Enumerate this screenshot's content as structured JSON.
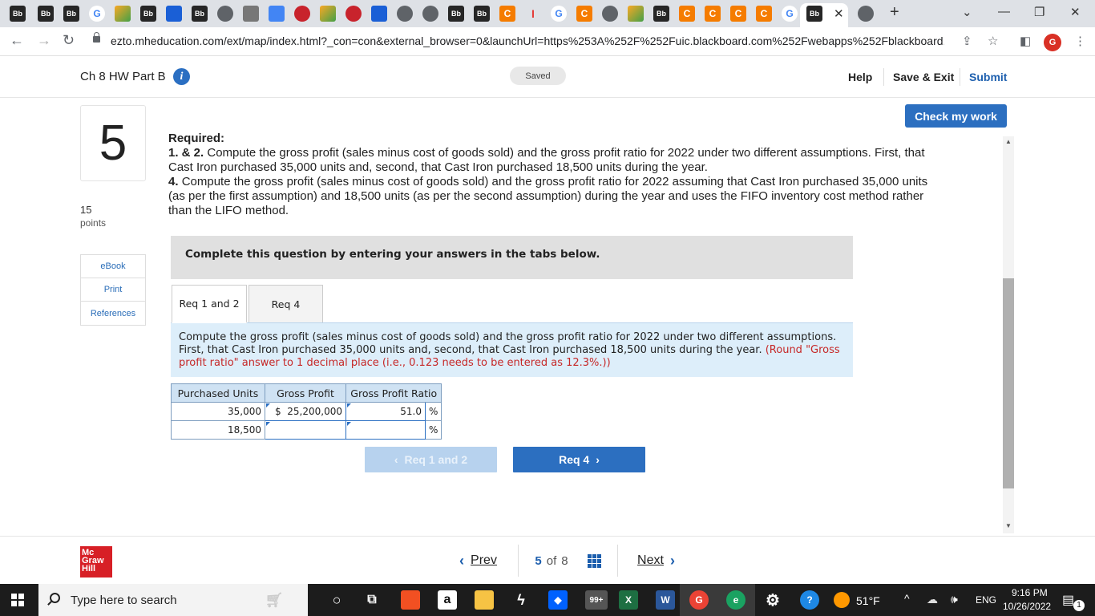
{
  "browser": {
    "url": "ezto.mheducation.com/ext/map/index.html?_con=con&external_browser=0&launchUrl=https%253A%252F%252Fuic.blackboard.com%252Fwebapps%252Fblackboard...",
    "profile_initial": "G",
    "tabs": [
      "Bb",
      "Bb",
      "Bb",
      "G",
      "",
      "Bb",
      "",
      "Bb",
      "",
      "",
      "",
      "",
      "",
      "",
      "",
      "",
      "Bb",
      "Bb",
      "C",
      "I",
      "G",
      "C",
      "",
      "",
      "Bb",
      "C",
      "C",
      "C",
      "C",
      "G",
      "Bb"
    ]
  },
  "header": {
    "title": "Ch 8 HW Part B",
    "saved": "Saved",
    "help": "Help",
    "save_exit": "Save & Exit",
    "submit": "Submit"
  },
  "question": {
    "number": "5",
    "points_value": "15",
    "points_label": "points",
    "rail_links": [
      "eBook",
      "Print",
      "References"
    ],
    "check_label": "Check my work",
    "required_label": "Required:",
    "req12_num": "1. & 2.",
    "req12_text": "Compute the gross profit (sales minus cost of goods sold) and the gross profit ratio for 2022 under two different assumptions. First, that Cast Iron purchased 35,000 units and, second, that Cast Iron purchased 18,500 units during the year.",
    "req4_num": "4.",
    "req4_text": "Compute the gross profit (sales minus cost of goods sold) and the gross profit ratio for 2022 assuming that Cast Iron purchased 35,000 units (as per the first assumption) and 18,500 units (as per the second assumption) during the year and uses the FIFO inventory cost method rather than the LIFO method.",
    "instruction": "Complete this question by entering your answers in the tabs below.",
    "tabs": [
      "Req 1 and 2",
      "Req 4"
    ],
    "prompt": "Compute the gross profit (sales minus cost of goods sold) and the gross profit ratio for 2022 under two different assumptions. First, that Cast Iron purchased 35,000 units and, second, that Cast Iron purchased 18,500 units during the year.",
    "prompt_note": "(Round \"Gross profit ratio\" answer to 1 decimal place (i.e., 0.123 needs to be entered as 12.3%.))",
    "table": {
      "headers": [
        "Purchased Units",
        "Gross Profit",
        "Gross Profit Ratio"
      ],
      "rows": [
        {
          "units": "35,000",
          "currency": "$",
          "gross_profit": "25,200,000",
          "ratio": "51.0",
          "pct": "%"
        },
        {
          "units": "18,500",
          "currency": "",
          "gross_profit": "",
          "ratio": "",
          "pct": "%"
        }
      ]
    },
    "nav_prev": "Req 1 and 2",
    "nav_next": "Req 4"
  },
  "footer": {
    "logo": [
      "Mc",
      "Graw",
      "Hill"
    ],
    "prev": "Prev",
    "current": "5",
    "of_label": "of",
    "total": "8",
    "next": "Next"
  },
  "taskbar": {
    "search_placeholder": "Type here to search",
    "mail_badge": "99+",
    "weather": "51°F",
    "language": "ENG",
    "time": "9:16 PM",
    "date": "10/26/2022",
    "notif_count": "1"
  },
  "colors": {
    "accent": "#2c6fc0",
    "prompt_bg": "#ddeefa",
    "note_red": "#c62828",
    "logo_red": "#d71f26"
  }
}
